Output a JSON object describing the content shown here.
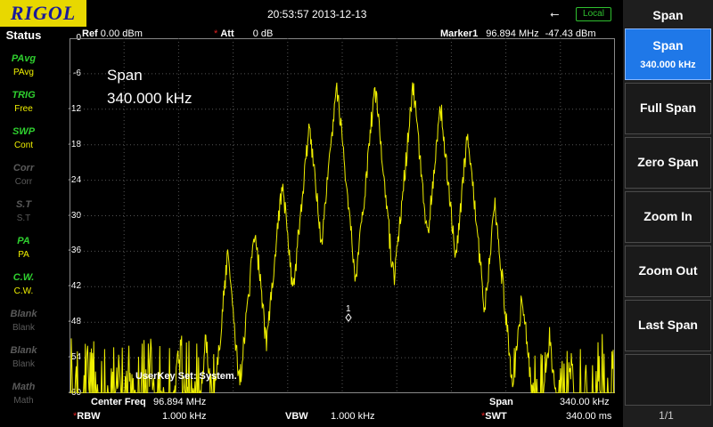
{
  "header": {
    "brand": "RIGOL",
    "datetime": "20:53:57 2013-12-13",
    "usb_icon": "usb-icon",
    "remote_status": "Local"
  },
  "status_panel": {
    "title": "Status",
    "items": [
      {
        "icon": "PAvg",
        "label": "PAvg",
        "state": "on"
      },
      {
        "icon": "TRIG",
        "label": "Free",
        "state": "on"
      },
      {
        "icon": "SWP",
        "label": "Cont",
        "state": "on"
      },
      {
        "icon": "Corr",
        "label": "Corr",
        "state": "off"
      },
      {
        "icon": "S.T",
        "label": "S.T",
        "state": "off"
      },
      {
        "icon": "PA",
        "label": "PA",
        "state": "on"
      },
      {
        "icon": "C.W.",
        "label": "C.W.",
        "state": "on"
      },
      {
        "icon": "Blank",
        "label": "Blank",
        "state": "off"
      },
      {
        "icon": "Blank",
        "label": "Blank",
        "state": "off"
      },
      {
        "icon": "Math",
        "label": "Math",
        "state": "off"
      }
    ]
  },
  "graph_header": {
    "ref_label": "Ref",
    "ref_value": "0.00 dBm",
    "att_label": "Att",
    "att_value": "0 dB",
    "marker_label": "Marker1",
    "marker_freq": "96.894 MHz",
    "marker_level": "-47.43 dBm"
  },
  "overlay": {
    "title": "Span",
    "value": "340.000 kHz",
    "userkey": "UserKey Set:   System."
  },
  "footer": {
    "center_label": "Center Freq",
    "center_value": "96.894 MHz",
    "span_label": "Span",
    "span_value": "340.00 kHz",
    "rbw_label": "RBW",
    "rbw_value": "1.000 kHz",
    "vbw_label": "VBW",
    "vbw_value": "1.000 kHz",
    "swt_label": "SWT",
    "swt_value": "340.00 ms"
  },
  "marker": {
    "label": "1"
  },
  "menu": {
    "title": "Span",
    "buttons": [
      {
        "label": "Span",
        "sub": "340.000 kHz",
        "active": true
      },
      {
        "label": "Full Span"
      },
      {
        "label": "Zero Span"
      },
      {
        "label": "Zoom In"
      },
      {
        "label": "Zoom Out"
      },
      {
        "label": "Last Span"
      },
      {
        "label": ""
      }
    ],
    "page": "1/1"
  },
  "chart_data": {
    "type": "line",
    "ylabels": [
      "0",
      "-6",
      "-12",
      "-18",
      "-24",
      "-30",
      "-36",
      "-42",
      "-48",
      "-54",
      "-60"
    ],
    "ylim": [
      -60,
      0
    ],
    "grid": true,
    "trace_color": "#f0f000",
    "trace_peaks": [
      {
        "x": 0.09,
        "y": -54
      },
      {
        "x": 0.15,
        "y": -55
      },
      {
        "x": 0.2,
        "y": -51
      },
      {
        "x": 0.25,
        "y": -49
      },
      {
        "x": 0.29,
        "y": -35
      },
      {
        "x": 0.34,
        "y": -30
      },
      {
        "x": 0.39,
        "y": -22
      },
      {
        "x": 0.44,
        "y": -12
      },
      {
        "x": 0.49,
        "y": -6
      },
      {
        "x": 0.56,
        "y": -6
      },
      {
        "x": 0.63,
        "y": -6
      },
      {
        "x": 0.68,
        "y": -9
      },
      {
        "x": 0.73,
        "y": -14
      },
      {
        "x": 0.78,
        "y": -26
      },
      {
        "x": 0.83,
        "y": -41
      },
      {
        "x": 0.88,
        "y": -48
      },
      {
        "x": 0.92,
        "y": -53
      },
      {
        "x": 0.97,
        "y": -55
      }
    ],
    "noise_floor": -60
  }
}
